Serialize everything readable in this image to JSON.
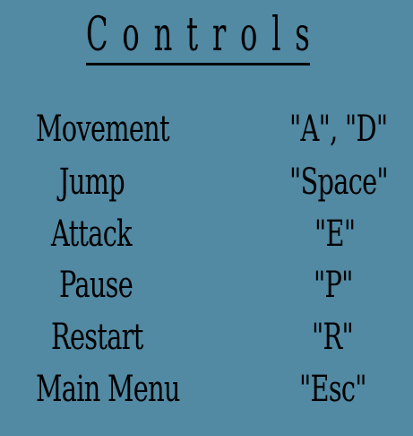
{
  "title": "Controls",
  "controls": [
    {
      "action": "Movement",
      "key": "\"A\", \"D\""
    },
    {
      "action": "Jump",
      "key": "\"Space\""
    },
    {
      "action": "Attack",
      "key": "\"E\""
    },
    {
      "action": "Pause",
      "key": "\"P\""
    },
    {
      "action": "Restart",
      "key": "\"R\""
    },
    {
      "action": "Main Menu",
      "key": "\"Esc\""
    }
  ],
  "colors": {
    "background": "#5289a3",
    "text": "#000000"
  }
}
